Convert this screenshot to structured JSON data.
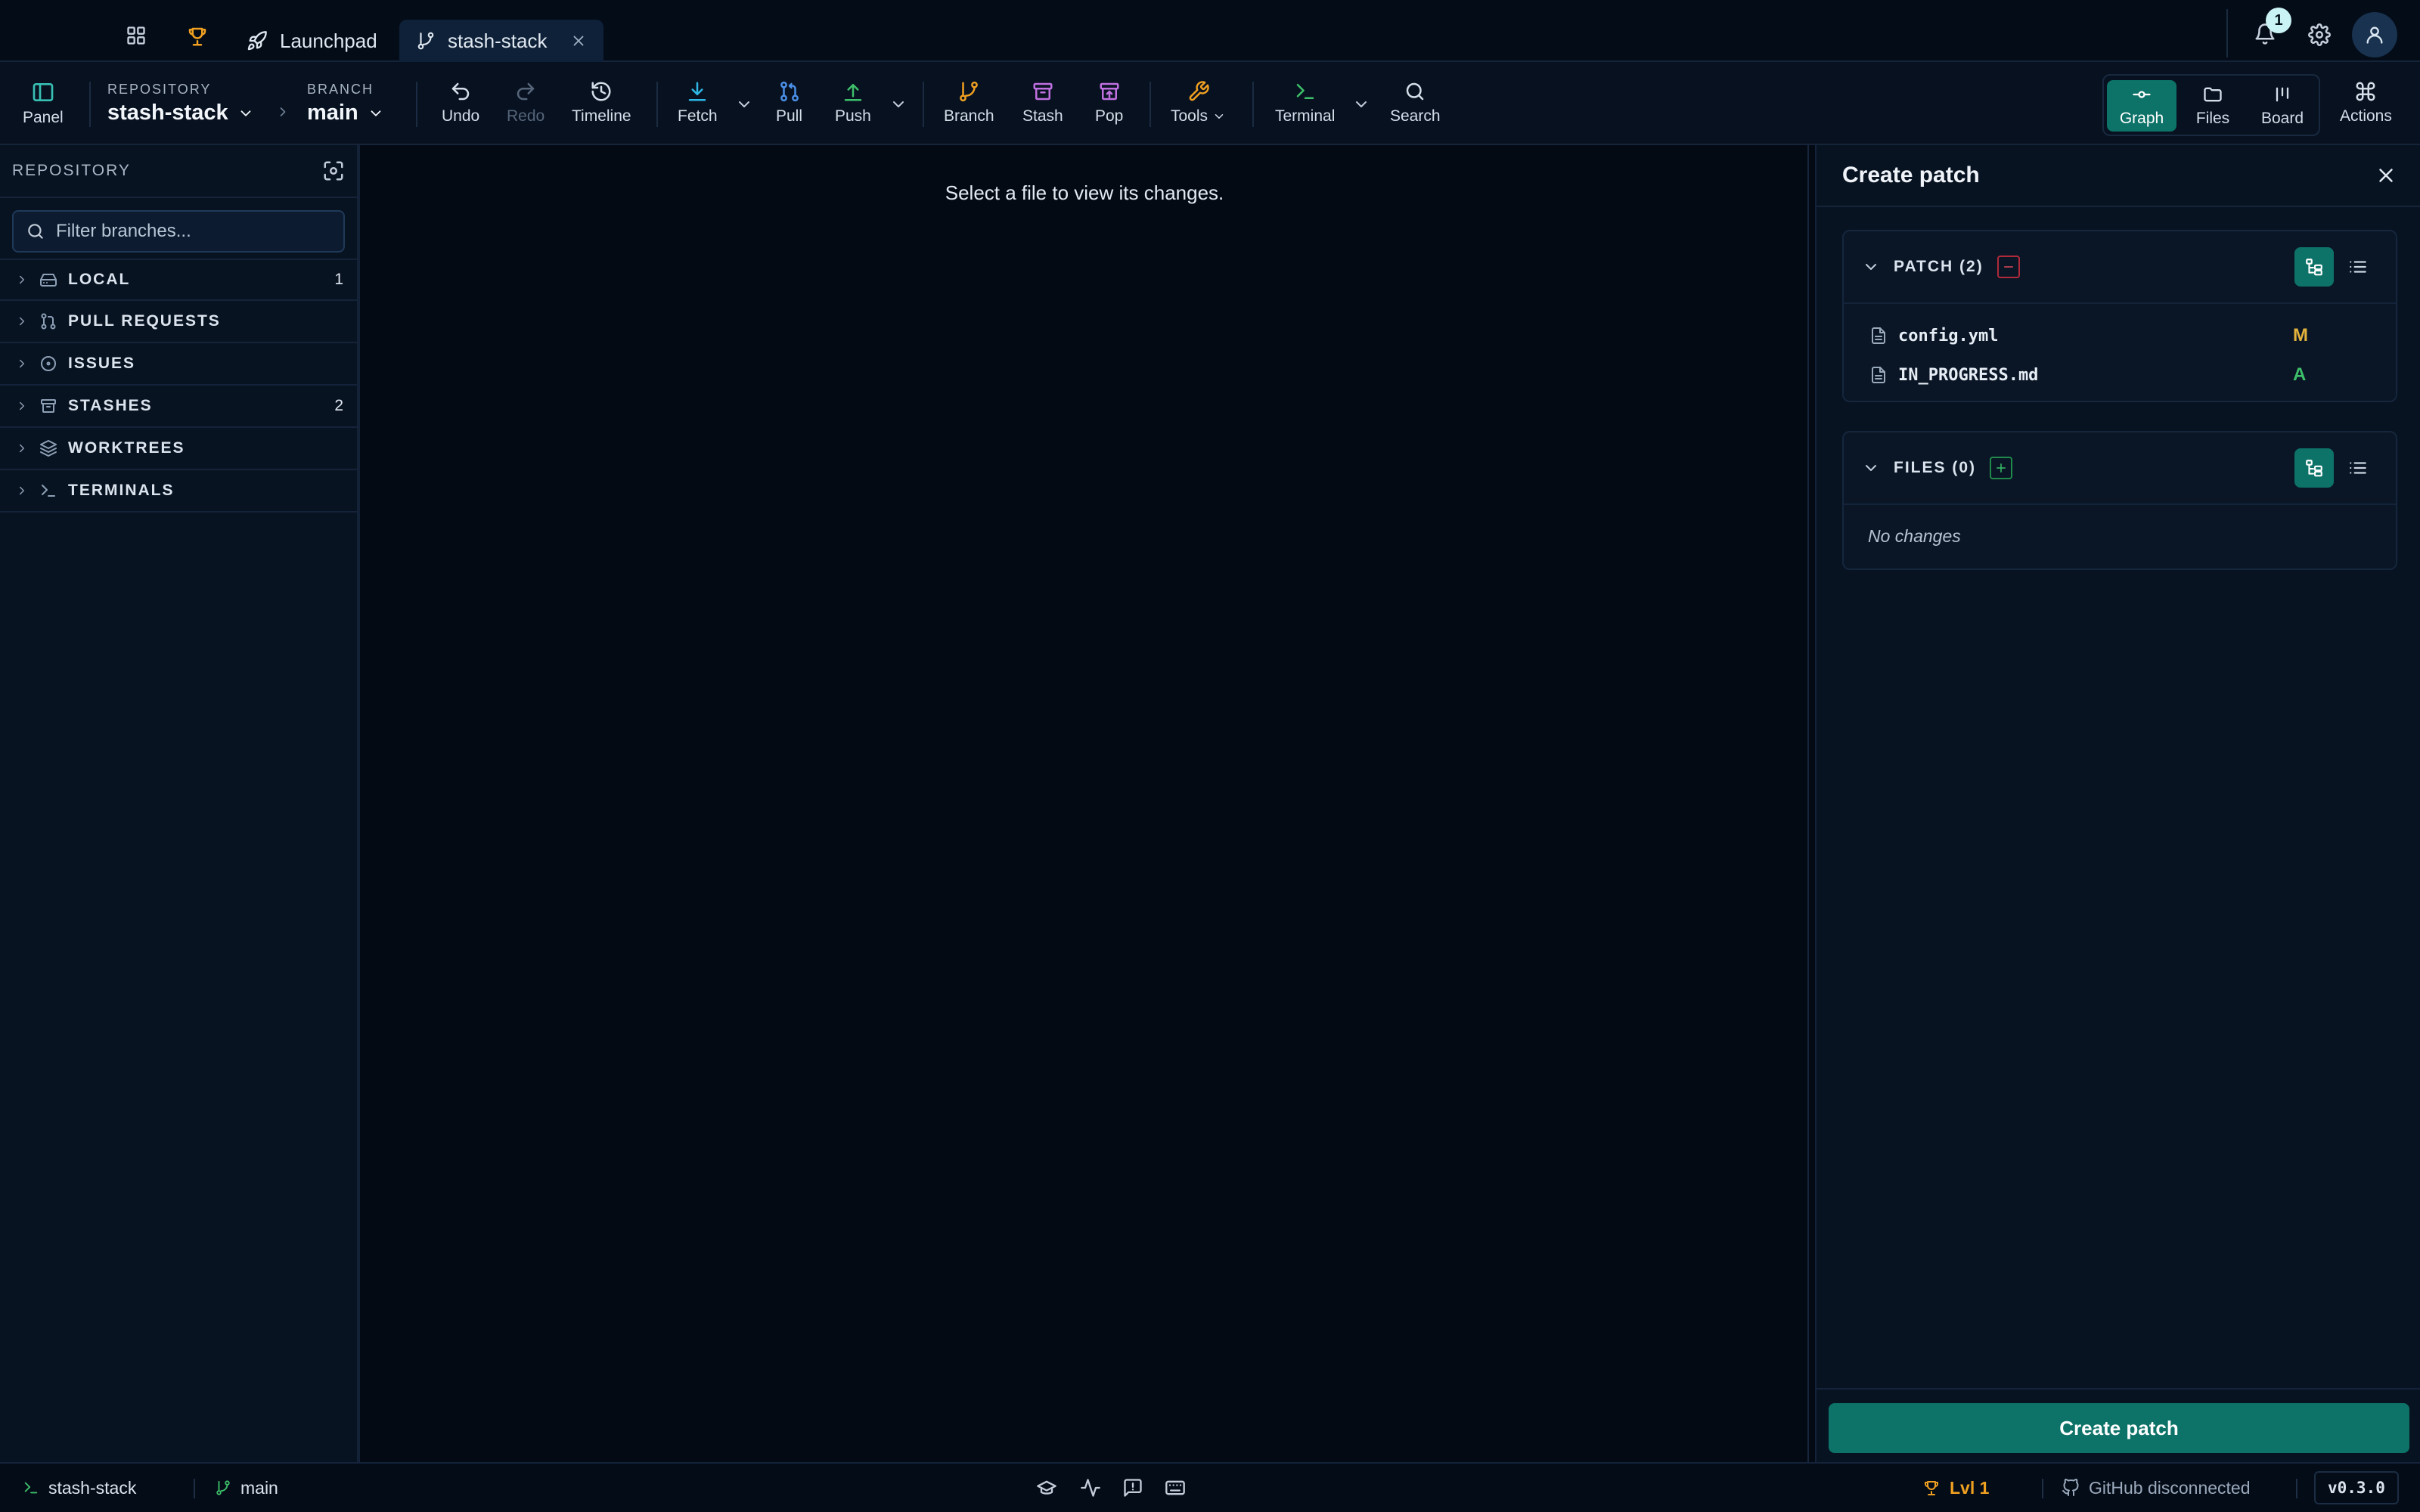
{
  "titlebar": {
    "tabs": [
      {
        "label": "Launchpad",
        "icon": "rocket-icon"
      },
      {
        "label": "stash-stack",
        "icon": "branch-icon",
        "active": true
      }
    ],
    "notification_count": "1"
  },
  "toolbar": {
    "panel_label": "Panel",
    "repository_caption": "REPOSITORY",
    "repository_name": "stash-stack",
    "branch_caption": "BRANCH",
    "branch_name": "main",
    "undo": "Undo",
    "redo": "Redo",
    "timeline": "Timeline",
    "fetch": "Fetch",
    "pull": "Pull",
    "push": "Push",
    "branch": "Branch",
    "stash": "Stash",
    "pop": "Pop",
    "tools": "Tools",
    "terminal": "Terminal",
    "search": "Search",
    "views": {
      "graph": "Graph",
      "files": "Files",
      "board": "Board"
    },
    "actions": "Actions"
  },
  "sidebar": {
    "title": "REPOSITORY",
    "filter_placeholder": "Filter branches...",
    "sections": [
      {
        "name": "LOCAL",
        "count": "1"
      },
      {
        "name": "PULL REQUESTS",
        "count": ""
      },
      {
        "name": "ISSUES",
        "count": ""
      },
      {
        "name": "STASHES",
        "count": "2"
      },
      {
        "name": "WORKTREES",
        "count": ""
      },
      {
        "name": "TERMINALS",
        "count": ""
      }
    ]
  },
  "main": {
    "empty_message": "Select a file to view its changes."
  },
  "panel": {
    "title": "Create patch",
    "patch_header": "PATCH (2)",
    "patch_files": [
      {
        "name": "config.yml",
        "status": "M"
      },
      {
        "name": "IN_PROGRESS.md",
        "status": "A"
      }
    ],
    "files_header": "FILES (0)",
    "no_changes": "No changes",
    "create_button": "Create patch"
  },
  "statusbar": {
    "repo": "stash-stack",
    "branch": "main",
    "level": "Lvl 1",
    "github": "GitHub disconnected",
    "version": "v0.3.0"
  },
  "colors": {
    "accent": "#0d7268",
    "modified": "#e3b23c",
    "added": "#3ec06a",
    "remove": "#e0485a",
    "level": "#f0a020"
  }
}
